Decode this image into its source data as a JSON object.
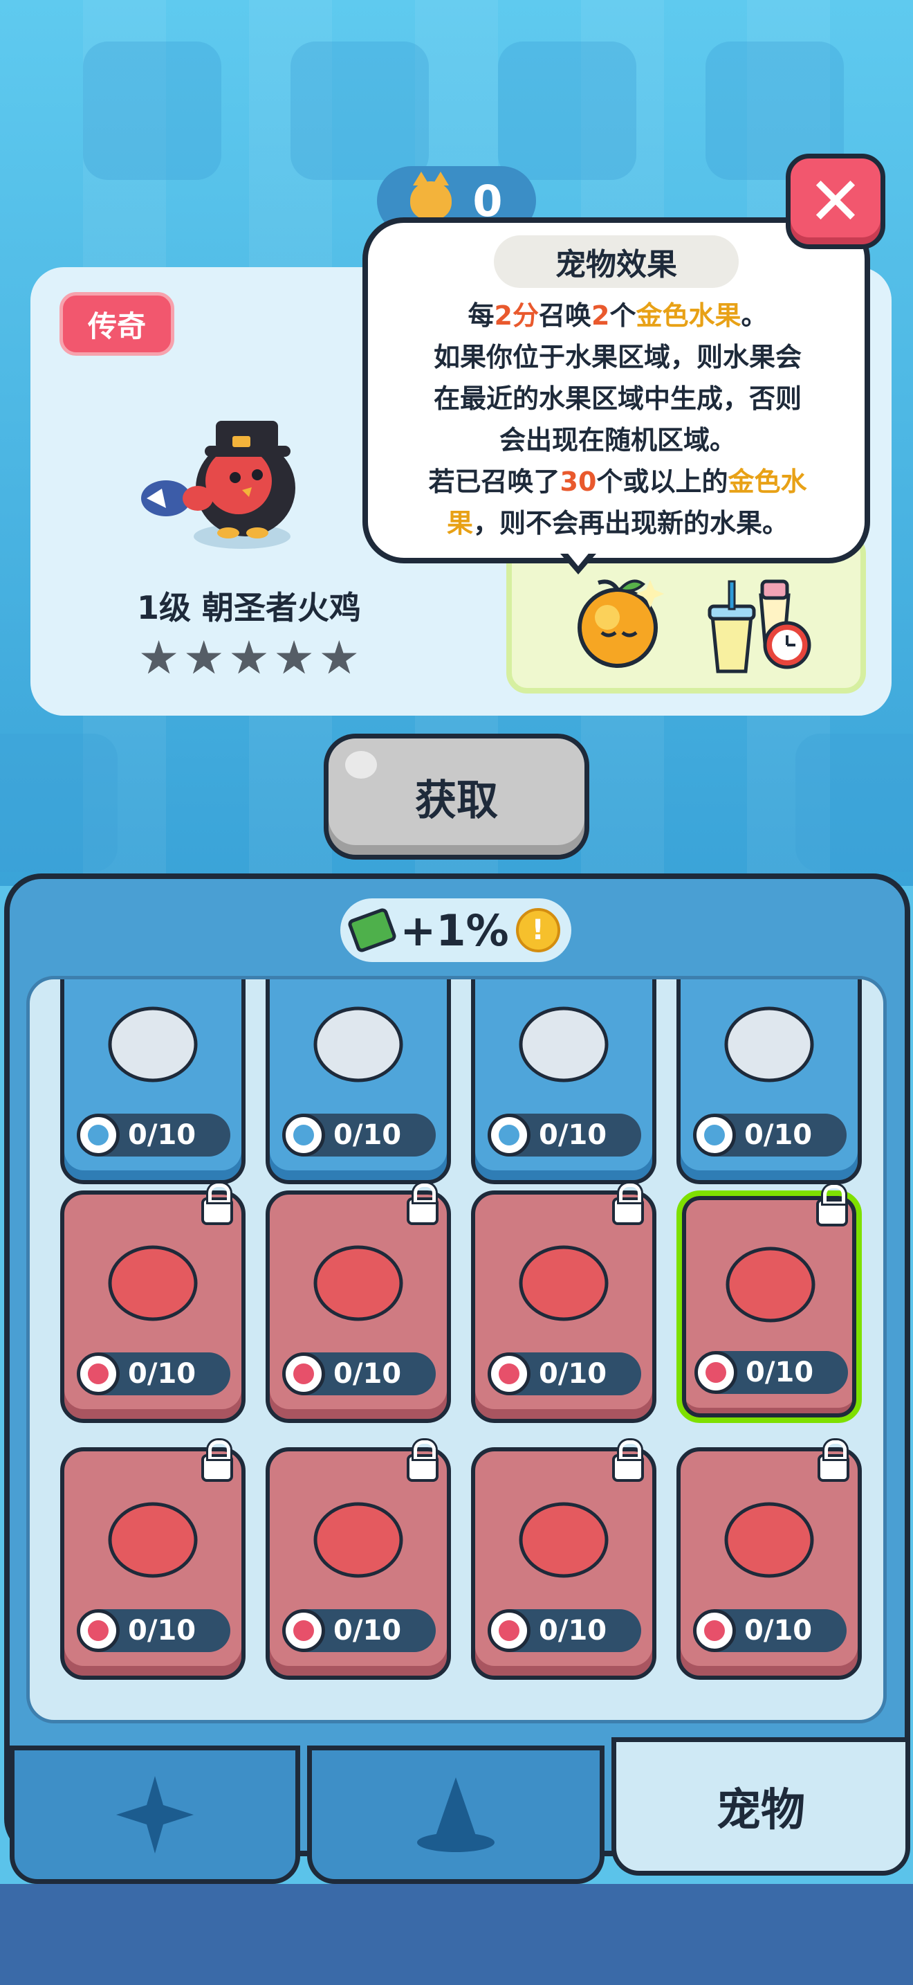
{
  "top_counter": {
    "value": "0",
    "icon": "cat-face-icon"
  },
  "pet": {
    "rarity": "传奇",
    "name": "1级 朝圣者火鸡",
    "stars_total": 5,
    "stars_filled": 0
  },
  "tooltip": {
    "title": "宠物效果",
    "line1_a": "每",
    "line1_b": "2分",
    "line1_c": "召唤",
    "line1_d": "2",
    "line1_e": "个",
    "line1_f": "金色水果",
    "line1_g": "。",
    "line2": "如果你位于水果区域，则水果会",
    "line3": "在最近的水果区域中生成，否则",
    "line4": "会出现在随机区域。",
    "line5_a": "若已召唤了",
    "line5_b": "30",
    "line5_c": "个或以上的",
    "line5_d": "金色水",
    "line6_a": "果",
    "line6_b": "，则不会再出现新的水果。"
  },
  "get_button": {
    "label": "获取"
  },
  "bonus": {
    "text": "+1%"
  },
  "slots": [
    {
      "count": "0/10",
      "style": "blue",
      "locked": false,
      "selected": false
    },
    {
      "count": "0/10",
      "style": "blue",
      "locked": false,
      "selected": false
    },
    {
      "count": "0/10",
      "style": "blue",
      "locked": false,
      "selected": false
    },
    {
      "count": "0/10",
      "style": "blue",
      "locked": false,
      "selected": false
    },
    {
      "count": "0/10",
      "style": "red",
      "locked": true,
      "selected": false
    },
    {
      "count": "0/10",
      "style": "red",
      "locked": true,
      "selected": false
    },
    {
      "count": "0/10",
      "style": "red",
      "locked": true,
      "selected": false
    },
    {
      "count": "0/10",
      "style": "red",
      "locked": true,
      "selected": true
    },
    {
      "count": "0/10",
      "style": "red",
      "locked": true,
      "selected": false
    },
    {
      "count": "0/10",
      "style": "red",
      "locked": true,
      "selected": false
    },
    {
      "count": "0/10",
      "style": "red",
      "locked": true,
      "selected": false
    },
    {
      "count": "0/10",
      "style": "red",
      "locked": true,
      "selected": false
    }
  ],
  "tabs": [
    {
      "icon": "star-icon",
      "label": ""
    },
    {
      "icon": "wizard-hat-icon",
      "label": ""
    },
    {
      "icon": "",
      "label": "宠物"
    }
  ]
}
